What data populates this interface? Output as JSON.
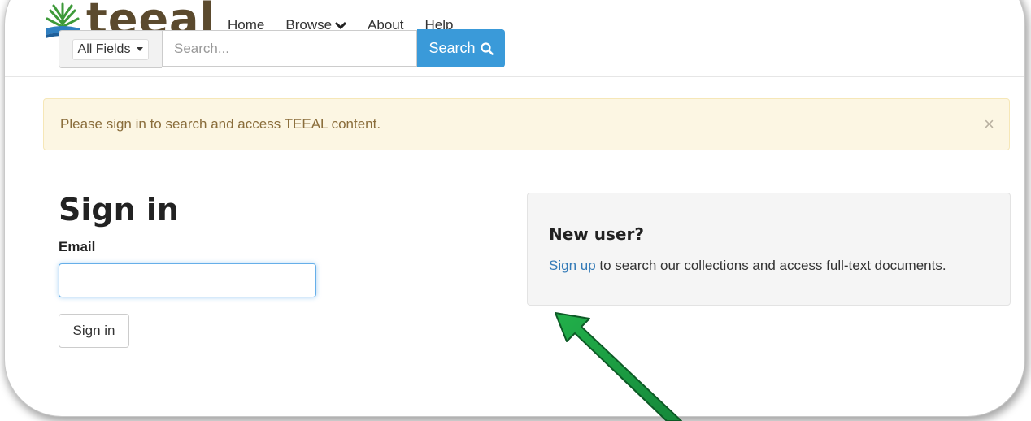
{
  "header": {
    "logo_text": "teeal",
    "nav": [
      {
        "label": "Home"
      },
      {
        "label": "Browse"
      },
      {
        "label": "About"
      },
      {
        "label": "Help"
      }
    ]
  },
  "search": {
    "field_selected": "All Fields",
    "placeholder": "Search...",
    "button_label": "Search"
  },
  "alert": {
    "message": "Please sign in to search and access TEEAL content.",
    "close_glyph": "×"
  },
  "signin": {
    "title": "Sign in",
    "email_label": "Email",
    "email_value": "",
    "button_label": "Sign in"
  },
  "new_user": {
    "title": "New user?",
    "link_label": "Sign up",
    "text": " to search our collections and access full-text documents."
  },
  "colors": {
    "accent": "#3a9ad9",
    "link": "#337ab7",
    "alert_bg": "#fcf6e3",
    "annotation_arrow": "#1a9a3a"
  }
}
